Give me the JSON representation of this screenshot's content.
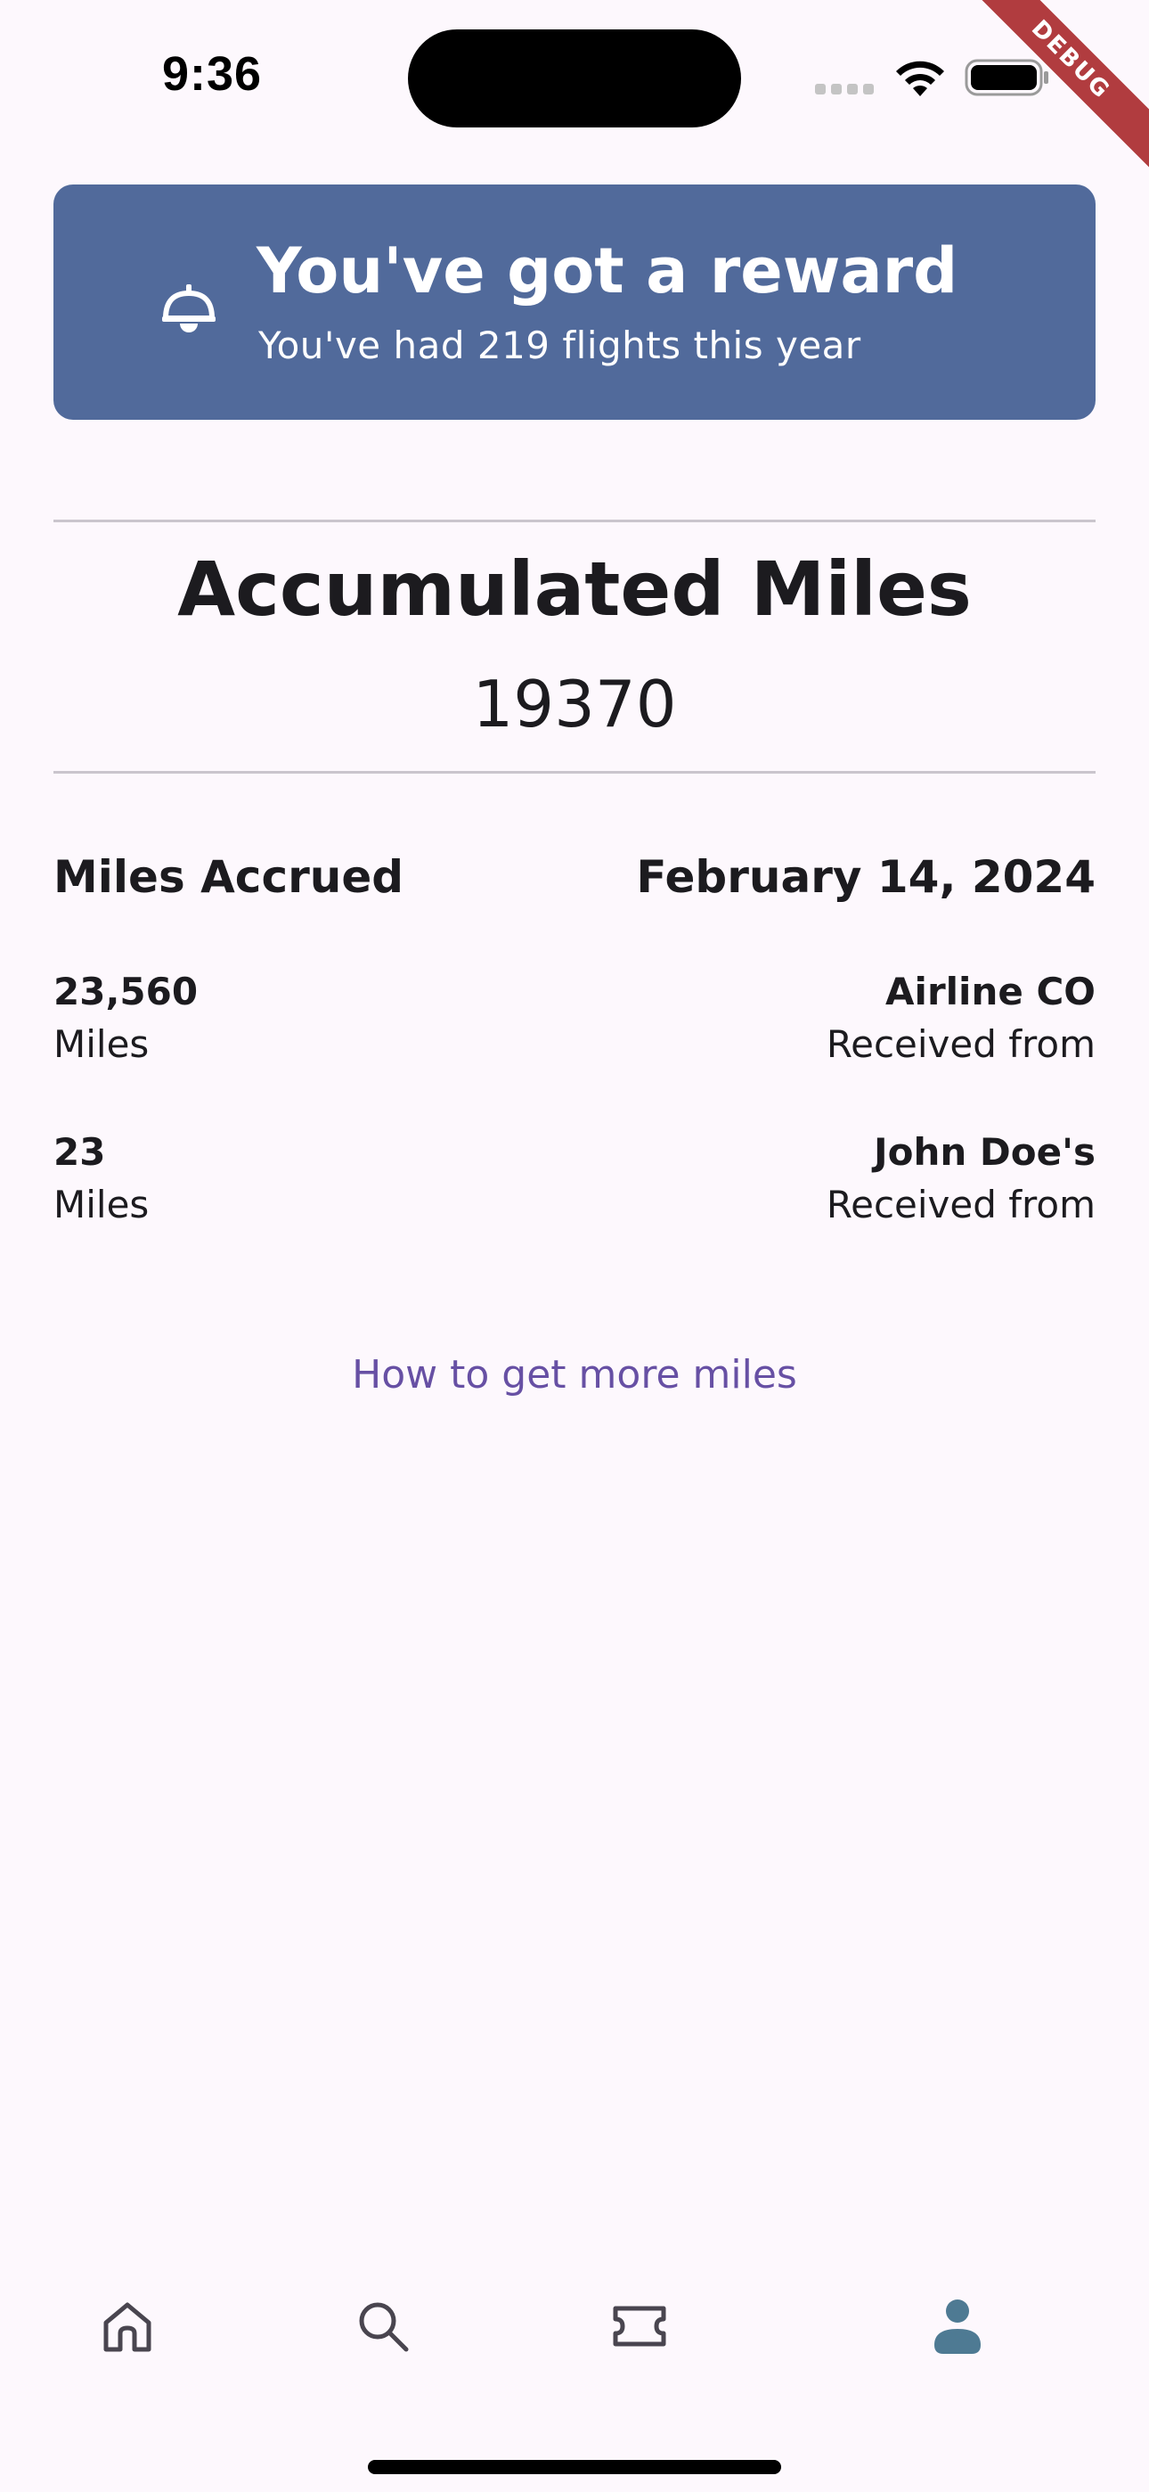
{
  "status_bar": {
    "time": "9:36"
  },
  "debug_banner": {
    "label": "DEBUG"
  },
  "reward": {
    "title": "You've got a reward",
    "subtitle": "You've had 219 flights this year",
    "icon": "bell-icon",
    "background_color": "#516a9b"
  },
  "accumulated": {
    "title": "Accumulated Miles",
    "total": "19370"
  },
  "accrued": {
    "header_label": "Miles Accrued",
    "date": "February 14, 2024",
    "entries": [
      {
        "amount": "23,560",
        "unit": "Miles",
        "source": "Airline CO",
        "source_caption": "Received from"
      },
      {
        "amount": "23",
        "unit": "Miles",
        "source": "John Doe's",
        "source_caption": "Received from"
      }
    ]
  },
  "more_link": {
    "label": "How to get more miles",
    "color": "#6750a4"
  },
  "bottom_nav": {
    "items": [
      {
        "icon": "home-icon",
        "active": false
      },
      {
        "icon": "search-icon",
        "active": false
      },
      {
        "icon": "ticket-icon",
        "active": false
      },
      {
        "icon": "person-icon",
        "active": true
      }
    ],
    "active_color": "#4e7a93"
  }
}
